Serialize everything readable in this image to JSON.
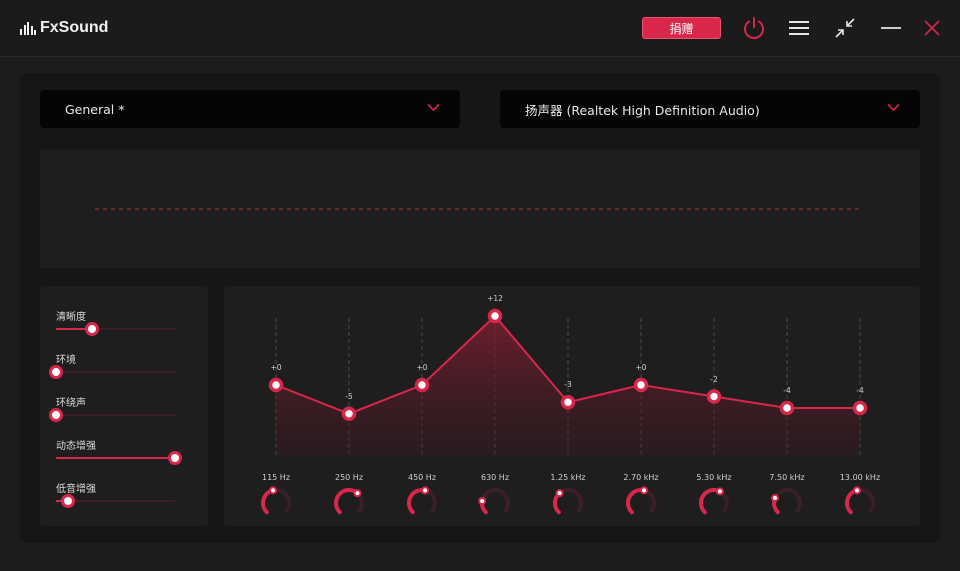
{
  "app": {
    "title": "FxSound",
    "donate_label": "捐赠"
  },
  "titlebar_icons": [
    "power-icon",
    "menu-icon",
    "minimize-to-widget-icon",
    "minimize-icon",
    "close-icon"
  ],
  "colors": {
    "accent": "#d8274a",
    "background": "#1c1c1c",
    "panel": "#1e1e1e"
  },
  "preset": {
    "selected": "General *"
  },
  "output_device": {
    "selected": "扬声器 (Realtek High Definition Audio)"
  },
  "effects": [
    {
      "label": "清晰度",
      "value": 0.3
    },
    {
      "label": "环境",
      "value": 0.0
    },
    {
      "label": "环绕声",
      "value": 0.0
    },
    {
      "label": "动态增强",
      "value": 1.0
    },
    {
      "label": "低音增强",
      "value": 0.1
    }
  ],
  "equalizer": {
    "bands": [
      {
        "freq": "115 Hz",
        "gain": 0,
        "gain_label": "+0"
      },
      {
        "freq": "250 Hz",
        "gain": -5,
        "gain_label": "-5"
      },
      {
        "freq": "450 Hz",
        "gain": 0,
        "gain_label": "+0"
      },
      {
        "freq": "630 Hz",
        "gain": 12,
        "gain_label": "+12"
      },
      {
        "freq": "1.25 kHz",
        "gain": -3,
        "gain_label": "-3"
      },
      {
        "freq": "2.70 kHz",
        "gain": 0,
        "gain_label": "+0"
      },
      {
        "freq": "5.30 kHz",
        "gain": -2,
        "gain_label": "-2"
      },
      {
        "freq": "7.50 kHz",
        "gain": -4,
        "gain_label": "-4"
      },
      {
        "freq": "13.00 kHz",
        "gain": -4,
        "gain_label": "-4"
      }
    ],
    "knob_levels": [
      0.45,
      0.65,
      0.55,
      0.2,
      0.35,
      0.55,
      0.6,
      0.25,
      0.45
    ]
  }
}
